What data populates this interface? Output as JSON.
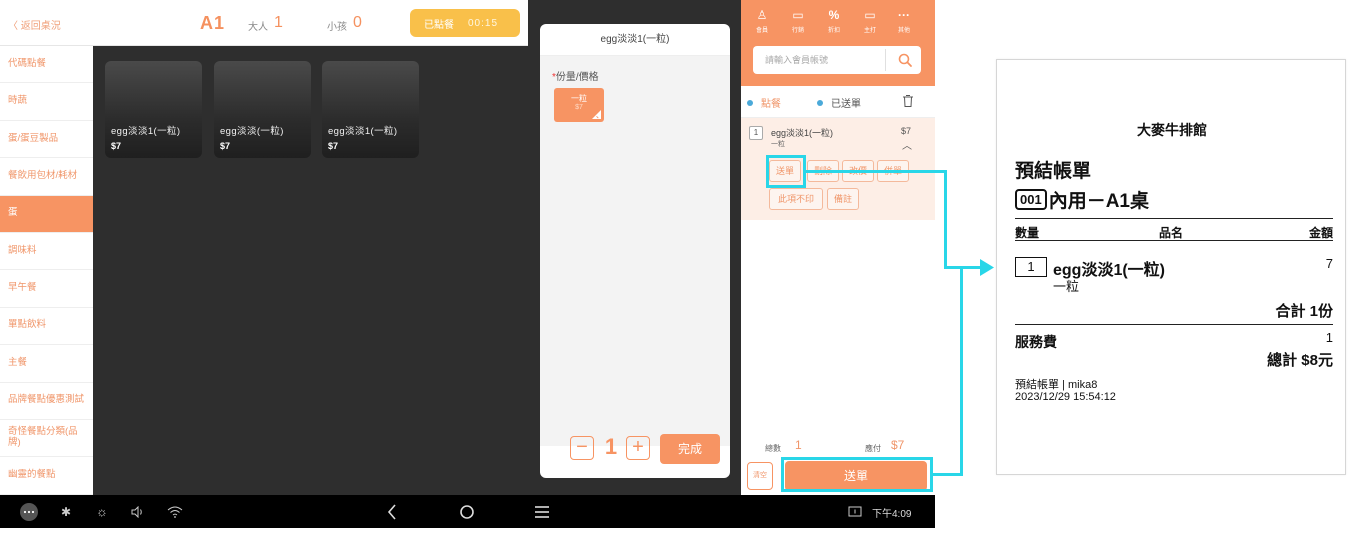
{
  "header": {
    "back_label": "〈 返回桌況",
    "table_name": "A1",
    "adult_label": "大人",
    "adult_count": "1",
    "child_label": "小孩",
    "child_count": "0",
    "ordered_label": "已點餐",
    "ordered_time": "00:15"
  },
  "categories": [
    {
      "label": "代碼點餐"
    },
    {
      "label": "時蔬"
    },
    {
      "label": "蛋/蛋豆製品"
    },
    {
      "label": "餐飲用包材/耗材"
    },
    {
      "label": "蛋",
      "active": true
    },
    {
      "label": "調味料"
    },
    {
      "label": "早午餐"
    },
    {
      "label": "單點飲料"
    },
    {
      "label": "主餐"
    },
    {
      "label": "品牌餐點優惠測試"
    },
    {
      "label": "奇怪餐點分類(品牌)"
    },
    {
      "label": "幽靈的餐點"
    }
  ],
  "products": [
    {
      "name": "egg淡淡1(一粒)",
      "price": "$7"
    },
    {
      "name": "egg淡淡(一粒)",
      "price": "$7"
    },
    {
      "name": "egg淡淡1(一粒)",
      "price": "$7"
    }
  ],
  "item_panel": {
    "title": "egg淡淡1(一粒)",
    "required_mark": "*",
    "size_label": "份量/價格",
    "size_option": {
      "label": "一粒",
      "price": "$7"
    },
    "quantity": "1",
    "minus": "−",
    "plus": "+",
    "done_label": "完成"
  },
  "toolbar": {
    "items": [
      {
        "icon": "person-icon",
        "glyph": "♙",
        "label": "會員"
      },
      {
        "icon": "card-icon",
        "glyph": "▭",
        "label": "行銷"
      },
      {
        "icon": "percent-icon",
        "glyph": "%",
        "label": "折扣"
      },
      {
        "icon": "monitor-icon",
        "glyph": "▭",
        "label": "主打"
      },
      {
        "icon": "more-icon",
        "glyph": "···",
        "label": "其他"
      }
    ],
    "search_placeholder": "請輸入會員帳號"
  },
  "order": {
    "tab_order": "點餐",
    "tab_sent": "已送單",
    "item": {
      "qty": "1",
      "name": "egg淡淡1(一粒)",
      "sub": "一粒",
      "price": "$7"
    },
    "actions": [
      "送單",
      "刪除",
      "改價",
      "併單",
      "此項不印",
      "備註"
    ],
    "total_count_label": "總數",
    "total_count": "1",
    "payable_label": "應付",
    "payable_value": "$7",
    "clear_label": "清空",
    "send_label": "送單"
  },
  "navbar": {
    "time": "下午4:09"
  },
  "receipt": {
    "store_name": "大麥牛排館",
    "title": "預結帳單",
    "order_no": "001",
    "order_type": "內用－A1桌",
    "col_qty": "數量",
    "col_name": "品名",
    "col_amount": "金額",
    "item_qty": "1",
    "item_name": "egg淡淡1(一粒)",
    "item_sub": "一粒",
    "item_amount": "7",
    "subtotal": "合計 1份",
    "service_label": "服務費",
    "service_value": "1",
    "total": "總計 $8元",
    "footer_line1": "預結帳單 | mika8",
    "footer_line2": "2023/12/29 15:54:12"
  },
  "colors": {
    "accent": "#f79463",
    "highlight": "#29d6e8",
    "ordered_badge": "#f9c04a"
  }
}
